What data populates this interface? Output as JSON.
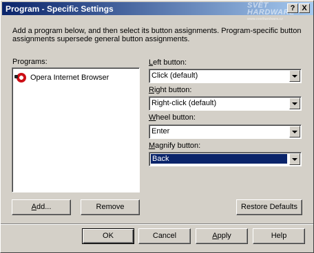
{
  "window": {
    "title": "Program - Specific Settings",
    "help_glyph": "?",
    "close_glyph": "X"
  },
  "watermark": {
    "line1": "SVĚT",
    "line2": "HARDWARE",
    "line3": "www.svethardware.cz"
  },
  "description": "Add a program below, and then select its button assignments. Program-specific button assignments supersede general button assignments.",
  "programs": {
    "label": "Programs:",
    "items": [
      {
        "name": "Opera Internet Browser",
        "icon": "opera-icon"
      }
    ]
  },
  "assignments": {
    "left": {
      "label_key": "L",
      "label_rest": "eft button:",
      "value": "Click (default)"
    },
    "right": {
      "label_key": "R",
      "label_rest": "ight button:",
      "value": "Right-click (default)"
    },
    "wheel": {
      "label_key": "W",
      "label_rest": "heel button:",
      "value": "Enter"
    },
    "magnify": {
      "label_key": "M",
      "label_rest": "agnify button:",
      "value": "Back"
    }
  },
  "buttons": {
    "add": {
      "key": "A",
      "rest": "dd..."
    },
    "remove": "Remove",
    "restore": "Restore Defaults",
    "ok": "OK",
    "cancel": "Cancel",
    "apply": {
      "key": "A",
      "rest": "pply"
    },
    "help": "Help"
  },
  "colors": {
    "titlebar_start": "#0a246a",
    "titlebar_end": "#a6caf0",
    "selection": "#0a246a",
    "face": "#d4d0c8"
  }
}
